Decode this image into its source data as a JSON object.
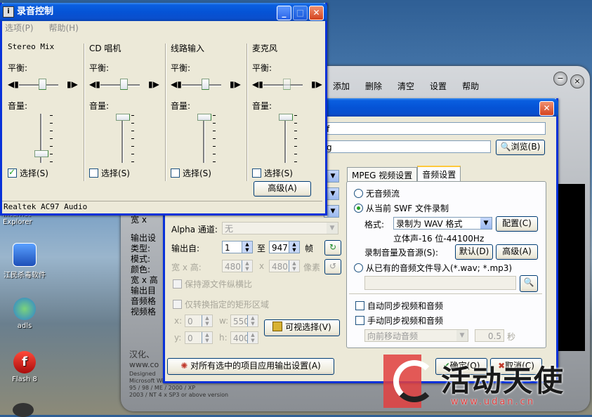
{
  "desktop": {
    "icons": [
      {
        "label": "Internet Explorer"
      },
      {
        "label": "江民杀毒软件"
      },
      {
        "label": "adls"
      },
      {
        "label": "Flash 8"
      }
    ]
  },
  "background_app": {
    "menu": [
      "添加",
      "删除",
      "清空",
      "设置",
      "帮助"
    ],
    "info_labels": [
      "宽 x",
      "输出设",
      "类型:",
      "模式:",
      "颜色:",
      "宽 x 高",
      "输出目",
      "音频格",
      "视频格"
    ],
    "about_lines": [
      "汉化、",
      "www.co",
      "Designed",
      "Microsoft Windows",
      "95 / 98 / ME / 2000 / XP",
      "2003 / NT 4 x SP3 or above version"
    ],
    "min_symbol": "−",
    "close_symbol": "×"
  },
  "recording_control": {
    "title": "录音控制",
    "menu": [
      "选项(P)",
      "帮助(H)"
    ],
    "balance_label": "平衡:",
    "volume_label": "音量:",
    "channels": [
      {
        "name": "Stereo Mix",
        "select_label": "选择(S)",
        "selected": true
      },
      {
        "name": "CD 唱机",
        "select_label": "选择(S)",
        "selected": false
      },
      {
        "name": "线路输入",
        "select_label": "选择(S)",
        "selected": false
      },
      {
        "name": "麦克风",
        "select_label": "选择(S)",
        "selected": false
      }
    ],
    "advanced_button": "高级(A)",
    "status": "Realtek AC97 Audio"
  },
  "settings_dialog": {
    "field1_partial": "f",
    "field2_partial": "g",
    "browse_button": "浏览(B)",
    "alpha_label": "Alpha 通道:",
    "alpha_value": "无",
    "output_from_label": "输出自:",
    "output_from_value": "1",
    "to_label": "至",
    "output_to_value": "947",
    "frame_unit": "帧",
    "wh_label": "宽 x 高:",
    "width_value": "480",
    "x_sep": "x",
    "height_value": "480",
    "pixel_unit": "像素",
    "keep_ratio": "保持源文件纵横比",
    "convert_rect": "仅转换指定的矩形区域",
    "x_label": "x:",
    "x_value": "0",
    "w_label": "w:",
    "w_value": "550",
    "y_label": "y:",
    "y_value": "0",
    "h_label": "h:",
    "h_value": "400",
    "visual_select_button": "可视选择(V)",
    "apply_all_button": "对所有选中的项目应用输出设置(A)",
    "tabs": [
      "MPEG 视频设置",
      "音频设置"
    ],
    "no_audio": "无音频流",
    "record_from_swf": "从当前 SWF 文件录制",
    "format_label": "格式:",
    "format_value": "录制为 WAV 格式",
    "config_button": "配置(C)",
    "stereo_info": "立体声-16 位-44100Hz",
    "rec_volume_label": "录制音量及音源(S):",
    "default_button": "默认(D)",
    "advanced_button": "高级(A)",
    "import_existing": "从已有的音频文件导入(*.wav; *.mp3)",
    "auto_sync": "自动同步视频和音频",
    "manual_sync": "手动同步视频和音频",
    "move_forward": "向前移动音频",
    "seconds_value": "0.5",
    "seconds_unit": "秒",
    "ok_button": "确定(O)",
    "cancel_button": "取消(C)"
  },
  "watermark": {
    "text": "活动天使",
    "url": "www.udan.cn"
  }
}
